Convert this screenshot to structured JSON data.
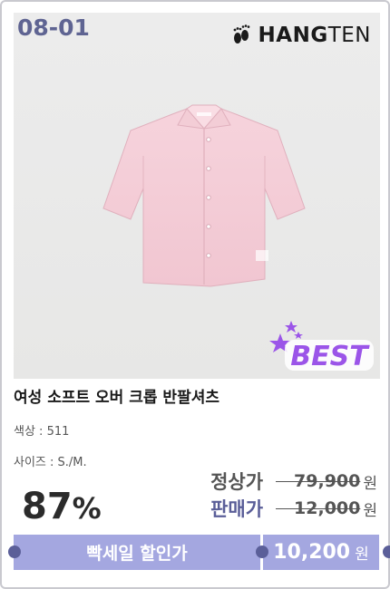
{
  "product": {
    "code": "08-01",
    "brand": {
      "bold": "HANG",
      "light": "TEN"
    },
    "badge": "BEST",
    "title": "여성 소프트 오버 크롭 반팔셔츠",
    "color_label": "색상",
    "color_value": " : 511",
    "size_label": "사이즈",
    "size_value": " : S./M."
  },
  "pricing": {
    "discount_number": "87",
    "discount_unit": "%",
    "regular_label": "정상가",
    "regular_amount": "79,900",
    "sale_label": "판매가",
    "sale_amount": "12,000",
    "currency": "원"
  },
  "promo": {
    "flash_label": "빡세일 할인가",
    "flash_amount": "10,200",
    "currency": "원"
  },
  "colors": {
    "accent_bar": "#a4a7e0",
    "code_text": "#5f6492",
    "badge": "#9b55e8",
    "shirt": "#f4ccd6"
  },
  "icons": [
    "footprint-icon",
    "star-icon"
  ]
}
